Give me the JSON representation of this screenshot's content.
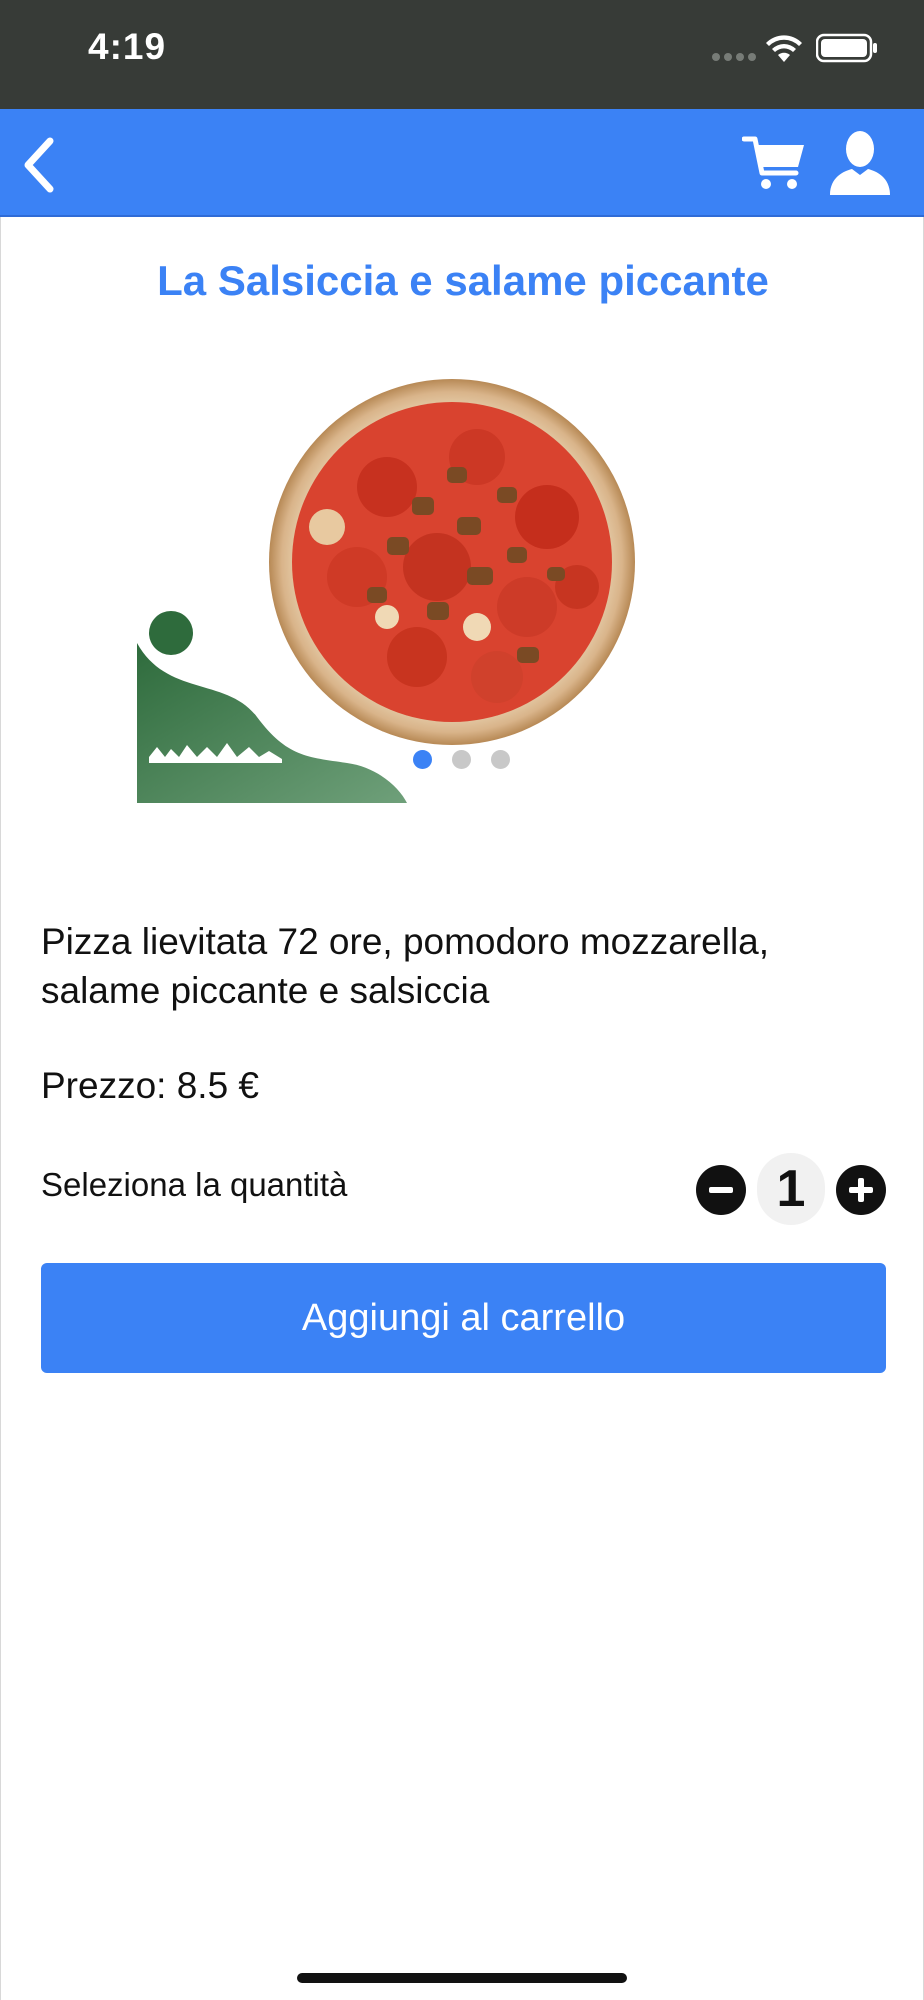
{
  "status_bar": {
    "time": "4:19",
    "icons": [
      "signal-dots-icon",
      "wifi-icon",
      "battery-icon"
    ]
  },
  "nav_bar": {
    "background_color": "#3b82f5",
    "icons": [
      "back-chevron-icon",
      "cart-icon",
      "user-icon"
    ]
  },
  "product": {
    "title": "La Salsiccia e salame piccante",
    "description": "Pizza lievitata 72 ore, pomodoro mozzarella, salame piccante e salsiccia",
    "price_text": "Prezzo: 8.5 €"
  },
  "carousel": {
    "images": [
      "pizza-photo",
      "restaurant-logo"
    ],
    "page_count": 3,
    "active_index": 0
  },
  "quantity": {
    "label": "Seleziona la quantità",
    "value": "1"
  },
  "add_to_cart_button": {
    "label": "Aggiungi al carrello"
  }
}
